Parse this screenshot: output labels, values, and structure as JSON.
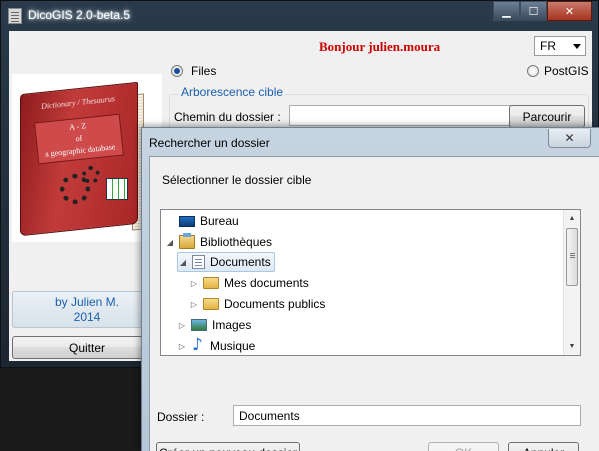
{
  "main_window": {
    "title": "DicoGIS 2.0-beta.5",
    "greeting": "Bonjour julien.moura",
    "language": "FR",
    "book": {
      "title": "Dictionary / Thesaurus",
      "label_line1": "A - Z",
      "label_line2": "of",
      "label_line3": "a geographic database"
    },
    "radio_files": "Files",
    "radio_postgis": "PostGIS",
    "group_title": "Arborescence cible",
    "folder_path_label": "Chemin du dossier :",
    "folder_path_value": "",
    "browse_button": "Parcourir",
    "author_line1": "by Julien M.",
    "author_line2": "2014",
    "quit_button": "Quitter"
  },
  "dialog": {
    "title": "Rechercher un dossier",
    "close_glyph": "✕",
    "instruction": "Sélectionner le dossier cible",
    "tree": [
      {
        "label": "Bureau",
        "icon": "desktop-icon",
        "expander": ""
      },
      {
        "label": "Bibliothèques",
        "icon": "libraries-icon",
        "expander": "◢"
      },
      {
        "label": "Documents",
        "icon": "documents-icon",
        "expander": "◢",
        "selected": true
      },
      {
        "label": "Mes documents",
        "icon": "folder-icon",
        "expander": "▷"
      },
      {
        "label": "Documents publics",
        "icon": "folder-icon",
        "expander": "▷"
      },
      {
        "label": "Images",
        "icon": "images-icon",
        "expander": "▷"
      },
      {
        "label": "Musique",
        "icon": "music-icon",
        "expander": "▷"
      }
    ],
    "folder_label": "Dossier :",
    "folder_value": "Documents",
    "new_folder_button": "Créer un nouveau dossier",
    "ok_button": "OK",
    "cancel_button": "Annuler"
  },
  "colors": {
    "greeting": "#cc0000",
    "accent_blue": "#1c5fb0",
    "window_frame": "#2a3a4a"
  }
}
